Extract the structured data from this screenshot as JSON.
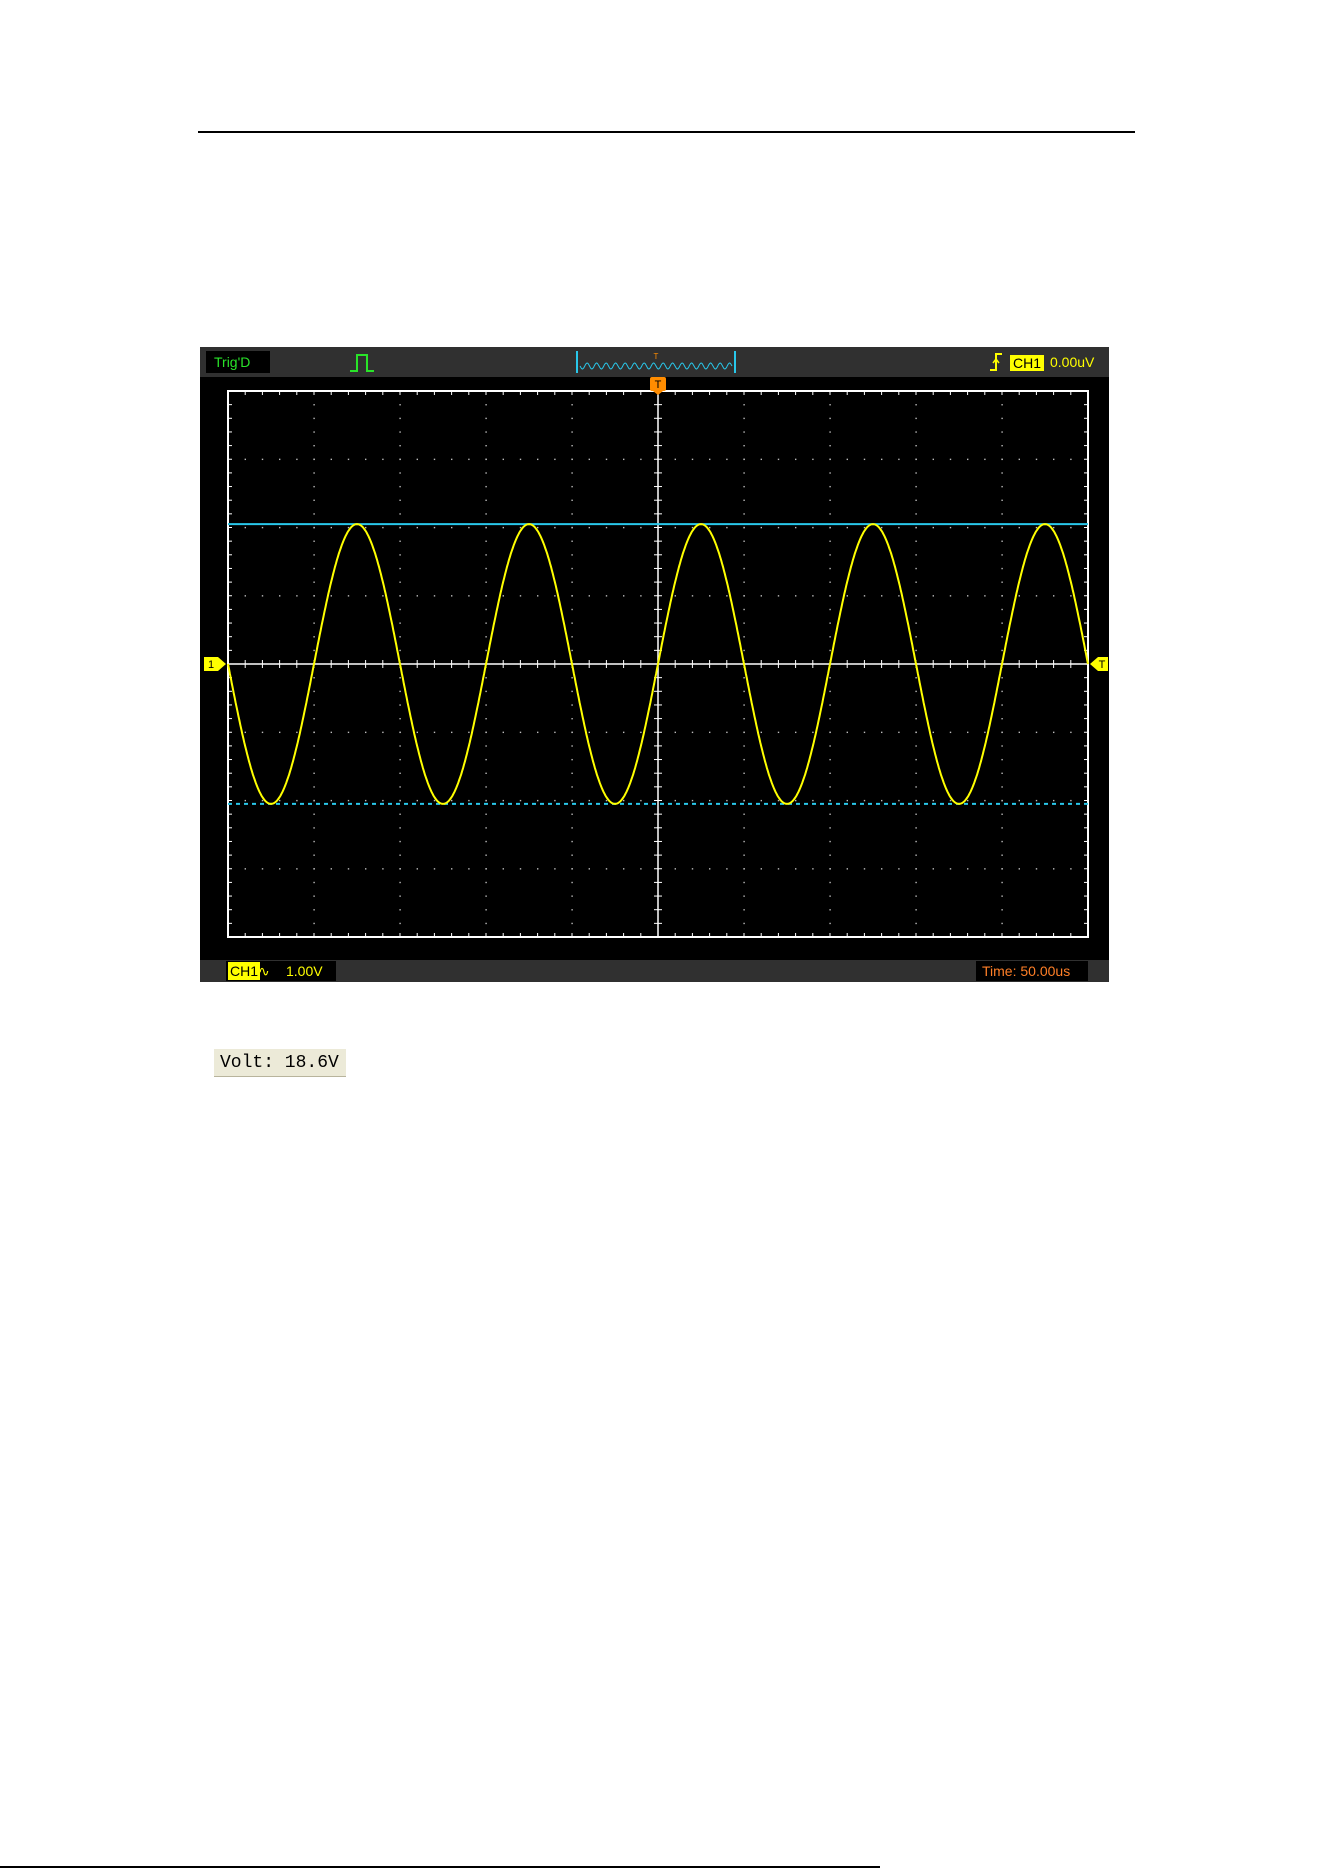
{
  "scope": {
    "trigger_status": "Trig'D",
    "trigger_source": "CH1",
    "trigger_level": "0.00uV",
    "channel_label": "CH1",
    "volts_per_div": "1.00V",
    "time_base": "Time: 50.00us",
    "ch1_marker": "1",
    "trigger_marker": "T",
    "colors": {
      "trace": "#ffff00",
      "cursor": "#29c7ea",
      "graticule": "#ffffff",
      "status_text": "#29e329",
      "time_text": "#ff7f27",
      "marker": "#ffff00",
      "trigger_pos_marker": "#ff8c00"
    },
    "icons": [
      "pulse-icon",
      "rising-edge-icon",
      "ac-coupling-icon"
    ],
    "coupling_symbol": "∿"
  },
  "chart_data": {
    "type": "line",
    "title": "",
    "xlabel": "",
    "ylabel": "",
    "divisions": {
      "horizontal": 10,
      "vertical": 8
    },
    "volts_per_div": 1.0,
    "time_per_div_us": 50,
    "xlim_div": [
      -5,
      5
    ],
    "ylim_div": [
      -4,
      4
    ],
    "series": [
      {
        "waveform": "sine",
        "amplitude_div": 2.05,
        "periods_on_screen": 5,
        "phase": "falling at left edge"
      }
    ],
    "cursors": [
      {
        "orientation": "horizontal",
        "style": "solid",
        "level_div": 2.05
      },
      {
        "orientation": "horizontal",
        "style": "dashed",
        "level_div": -2.05
      }
    ]
  },
  "volt_readout": "Volt: 18.6V"
}
